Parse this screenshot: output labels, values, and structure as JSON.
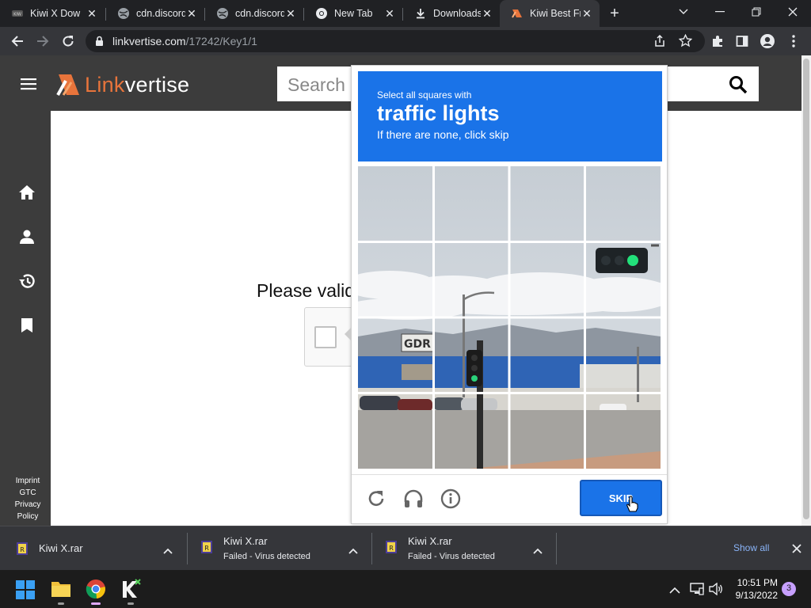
{
  "browser": {
    "tabs": [
      {
        "title": "Kiwi X Dow",
        "icon": "kiwi-tab-icon"
      },
      {
        "title": "cdn.discord",
        "icon": "globe-icon"
      },
      {
        "title": "cdn.discord",
        "icon": "globe-icon"
      },
      {
        "title": "New Tab",
        "icon": "chrome-icon"
      },
      {
        "title": "Downloads",
        "icon": "download-icon"
      },
      {
        "title": "Kiwi Best Fr",
        "icon": "linkvertise-icon",
        "active": true
      }
    ],
    "url_host": "linkvertise.com",
    "url_path": "/17242/Key1/1"
  },
  "page": {
    "logo_text_1": "Link",
    "logo_text_2": "vertise",
    "search_placeholder": "Search",
    "validate_text": "Please valid",
    "footer_links": [
      "Imprint",
      "GTC",
      "Privacy",
      "Policy"
    ]
  },
  "captcha": {
    "instruction_top": "Select all squares with",
    "instruction_target": "traffic lights",
    "instruction_bottom": "If there are none, click skip",
    "skip_label": "SKIP"
  },
  "downloads": {
    "items": [
      {
        "name": "Kiwi X.rar",
        "status": ""
      },
      {
        "name": "Kiwi X.rar",
        "status": "Failed - Virus detected"
      },
      {
        "name": "Kiwi X.rar",
        "status": "Failed - Virus detected"
      }
    ],
    "show_all": "Show all"
  },
  "taskbar": {
    "time": "10:51 PM",
    "date": "9/13/2022",
    "notification_count": "3"
  },
  "colors": {
    "accent_blue": "#1a73e8",
    "linkvertise_orange": "#e8743b",
    "header_dark": "#3c3c3c"
  }
}
